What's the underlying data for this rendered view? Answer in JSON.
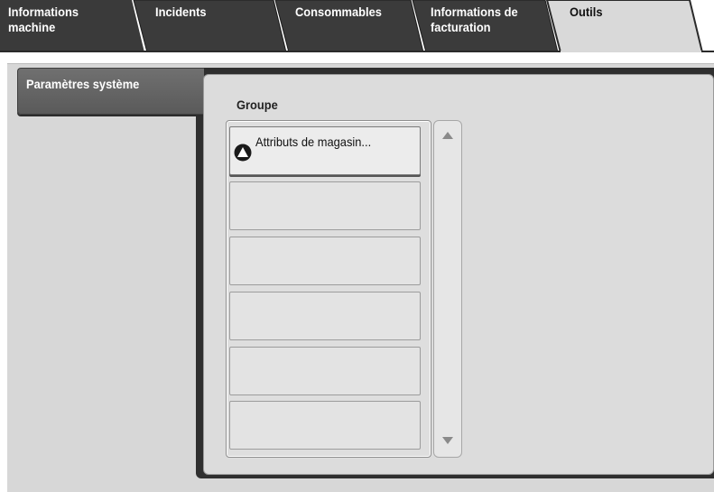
{
  "tabs": [
    {
      "label": "Informations\nmachine",
      "active": false
    },
    {
      "label": "Incidents",
      "active": false
    },
    {
      "label": "Consommables",
      "active": false
    },
    {
      "label": "Informations de\nfacturation",
      "active": false
    },
    {
      "label": "Outils",
      "active": true
    }
  ],
  "sidebar": {
    "selected_label": "Paramètres système"
  },
  "group": {
    "title": "Groupe",
    "items": [
      {
        "label": "Attributs de magasin...",
        "icon": "triangle-up-circle-icon"
      },
      {
        "label": ""
      },
      {
        "label": ""
      },
      {
        "label": ""
      },
      {
        "label": ""
      },
      {
        "label": ""
      }
    ]
  },
  "colors": {
    "tab_inactive": "#3a3a3a",
    "tab_active": "#d9d9d9",
    "panel_bg": "#d7d7d7",
    "content_frame": "#2f2f2f"
  }
}
